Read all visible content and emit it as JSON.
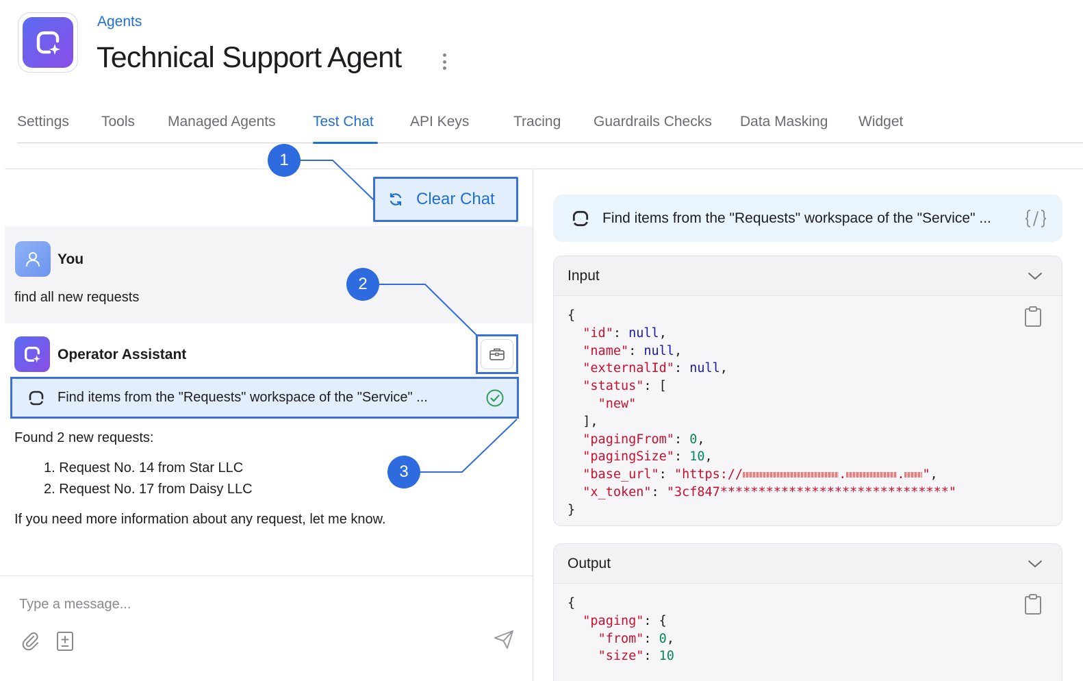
{
  "header": {
    "breadcrumb": "Agents",
    "title": "Technical Support Agent"
  },
  "tabs": [
    {
      "label": "Settings",
      "active": false
    },
    {
      "label": "Tools",
      "active": false
    },
    {
      "label": "Managed Agents",
      "active": false
    },
    {
      "label": "Test Chat",
      "active": true
    },
    {
      "label": "API Keys",
      "active": false
    },
    {
      "label": "Tracing",
      "active": false
    },
    {
      "label": "Guardrails Checks",
      "active": false
    },
    {
      "label": "Data Masking",
      "active": false
    },
    {
      "label": "Widget",
      "active": false
    }
  ],
  "chat": {
    "clear_label": "Clear Chat",
    "user": {
      "author": "You",
      "text": "find all new requests"
    },
    "assistant": {
      "author": "Operator Assistant",
      "tool_call": "Find items from the \"Requests\" workspace of the \"Service\" ...",
      "tool_status": "success",
      "intro": "Found 2 new requests:",
      "items": [
        "1. Request No. 14 from Star LLC",
        "2. Request No. 17 from Daisy LLC"
      ],
      "outro": "If you need more information about any request, let me know."
    },
    "composer": {
      "placeholder": "Type a message..."
    }
  },
  "callouts": [
    "1",
    "2",
    "3"
  ],
  "details": {
    "tool_title": "Find items from the \"Requests\" workspace of the \"Service\" ...",
    "input": {
      "title": "Input",
      "lines": {
        "id_key": "\"id\"",
        "id_val": "null",
        "name_key": "\"name\"",
        "name_val": "null",
        "ext_key": "\"externalId\"",
        "ext_val": "null",
        "status_key": "\"status\"",
        "status_item": "\"new\"",
        "pf_key": "\"pagingFrom\"",
        "pf_val": "0",
        "ps_key": "\"pagingSize\"",
        "ps_val": "10",
        "url_key": "\"base_url\"",
        "url_prefix": "\"https://",
        "tok_key": "\"x_token\"",
        "tok_val": "\"3cf847******************************\""
      }
    },
    "output": {
      "title": "Output",
      "lines": {
        "paging_key": "\"paging\"",
        "from_key": "\"from\"",
        "from_val": "0",
        "size_key": "\"size\"",
        "size_val": "10"
      }
    }
  },
  "colors": {
    "accent": "#1f6fd1",
    "annotation": "#2e6bdf",
    "success": "#2e9e5b",
    "json_key": "#c8102e",
    "json_null": "#1a1aa6",
    "json_number": "#098658"
  },
  "icons": {
    "app": "sparkle-loop-icon",
    "refresh": "refresh-icon",
    "user": "user-icon",
    "toolbox": "toolbox-icon",
    "check": "check-circle-icon",
    "code": "code-braces-icon",
    "chevron": "chevron-down-icon",
    "copy": "clipboard-icon",
    "attach": "paperclip-icon",
    "template": "document-plus-icon",
    "send": "send-icon"
  }
}
